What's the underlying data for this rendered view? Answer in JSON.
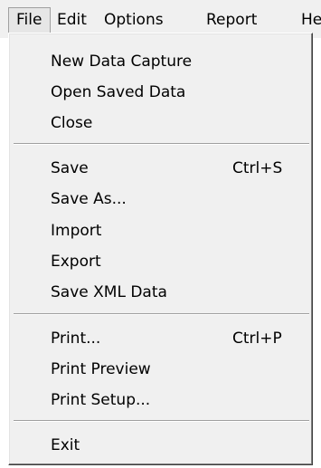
{
  "menubar": {
    "items": [
      {
        "label": "File"
      },
      {
        "label": "Edit"
      },
      {
        "label": "Options"
      },
      {
        "label": "Report"
      },
      {
        "label": "He"
      }
    ]
  },
  "file_menu": {
    "items": [
      {
        "label": "New Data Capture",
        "shortcut": ""
      },
      {
        "label": "Open Saved Data",
        "shortcut": ""
      },
      {
        "label": "Close",
        "shortcut": ""
      },
      {
        "label": "Save",
        "shortcut": "Ctrl+S"
      },
      {
        "label": "Save As...",
        "shortcut": ""
      },
      {
        "label": "Import",
        "shortcut": ""
      },
      {
        "label": "Export",
        "shortcut": ""
      },
      {
        "label": "Save XML Data",
        "shortcut": ""
      },
      {
        "label": "Print...",
        "shortcut": "Ctrl+P"
      },
      {
        "label": "Print Preview",
        "shortcut": ""
      },
      {
        "label": "Print Setup...",
        "shortcut": ""
      },
      {
        "label": "Exit",
        "shortcut": ""
      }
    ]
  }
}
